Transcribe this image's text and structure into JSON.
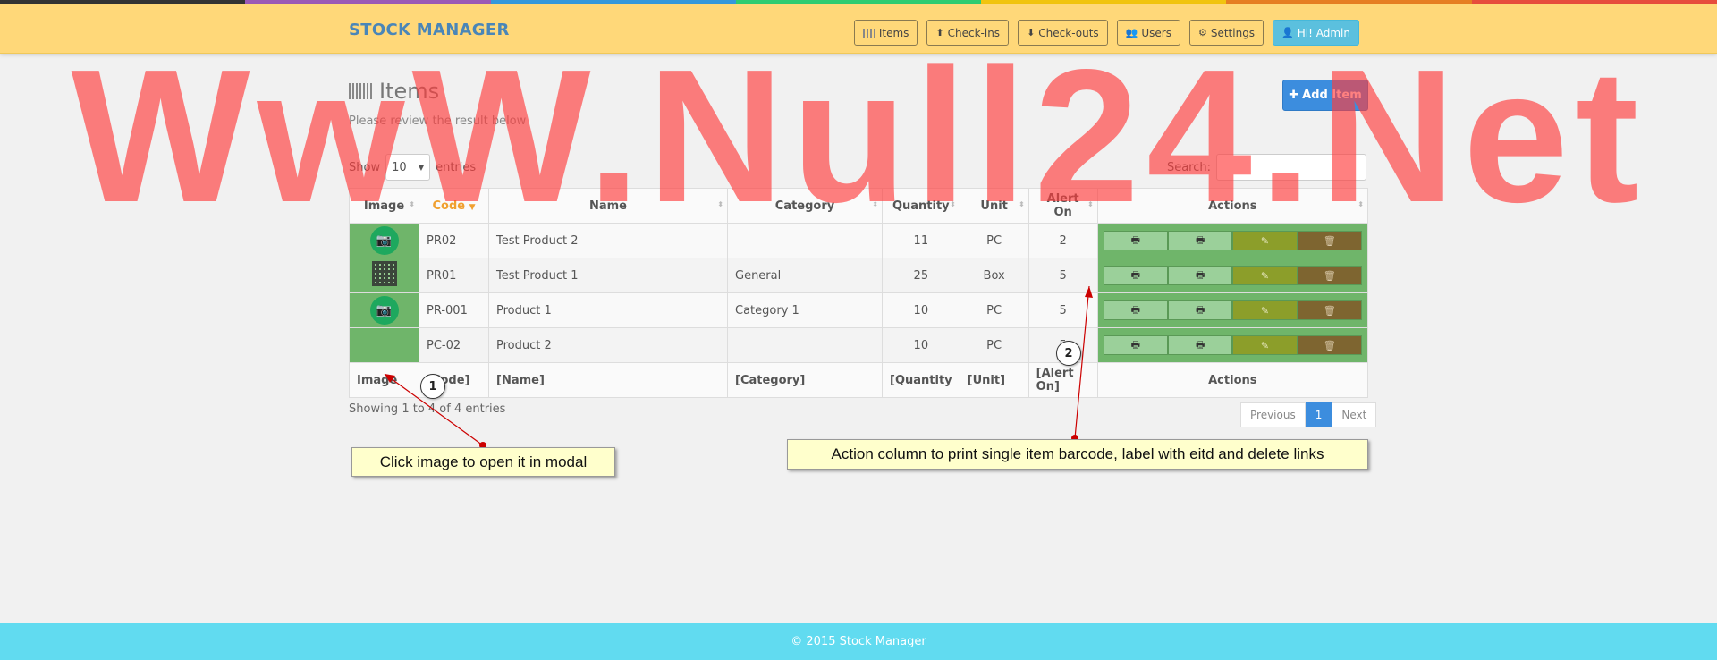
{
  "stripe_colors": [
    "#333333",
    "#9b59b6",
    "#3498db",
    "#2ecc71",
    "#f1c40f",
    "#e67e22",
    "#e74c3c"
  ],
  "brand": "STOCK MANAGER",
  "nav": [
    {
      "icon": "barcode-icon",
      "label": "Items"
    },
    {
      "icon": "circle-arrow-up-icon",
      "label": "Check-ins"
    },
    {
      "icon": "circle-arrow-down-icon",
      "label": "Check-outs"
    },
    {
      "icon": "users-icon",
      "label": "Users"
    },
    {
      "icon": "gears-icon",
      "label": "Settings"
    },
    {
      "icon": "user-icon",
      "label": "Hi! Admin"
    }
  ],
  "page": {
    "title": "Items",
    "subtitle": "Please review the result below",
    "add_button": "Add Item"
  },
  "table_controls": {
    "show_label": "Show",
    "entries_value": "10",
    "entries_label": "entries",
    "search_label": "Search:"
  },
  "columns": [
    "Image",
    "Code",
    "Name",
    "Category",
    "Quantity",
    "Unit",
    "Alert On",
    "Actions"
  ],
  "rows": [
    {
      "image": "photo",
      "code": "PR02",
      "name": "Test Product 2",
      "category": "",
      "quantity": "11",
      "unit": "PC",
      "alert_on": "2"
    },
    {
      "image": "qr",
      "code": "PR01",
      "name": "Test Product 1",
      "category": "General",
      "quantity": "25",
      "unit": "Box",
      "alert_on": "5"
    },
    {
      "image": "photo",
      "code": "PR-001",
      "name": "Product 1",
      "category": "Category 1",
      "quantity": "10",
      "unit": "PC",
      "alert_on": "5"
    },
    {
      "image": "none",
      "code": "PC-02",
      "name": "Product 2",
      "category": "",
      "quantity": "10",
      "unit": "PC",
      "alert_on": "5"
    }
  ],
  "footer_row": [
    "Image",
    "[Code]",
    "[Name]",
    "[Category]",
    "[Quantity",
    "[Unit]",
    "[Alert On]",
    "Actions"
  ],
  "info": "Showing 1 to 4 of 4 entries",
  "pagination": {
    "previous": "Previous",
    "current": "1",
    "next": "Next"
  },
  "annotations": [
    {
      "number": "1",
      "text": "Click image to open it in modal"
    },
    {
      "number": "2",
      "text": "Action column to print single item barcode, label with eitd and delete links"
    }
  ],
  "footer": "© 2015 Stock Manager",
  "watermark": "WwW.Null24.Net"
}
